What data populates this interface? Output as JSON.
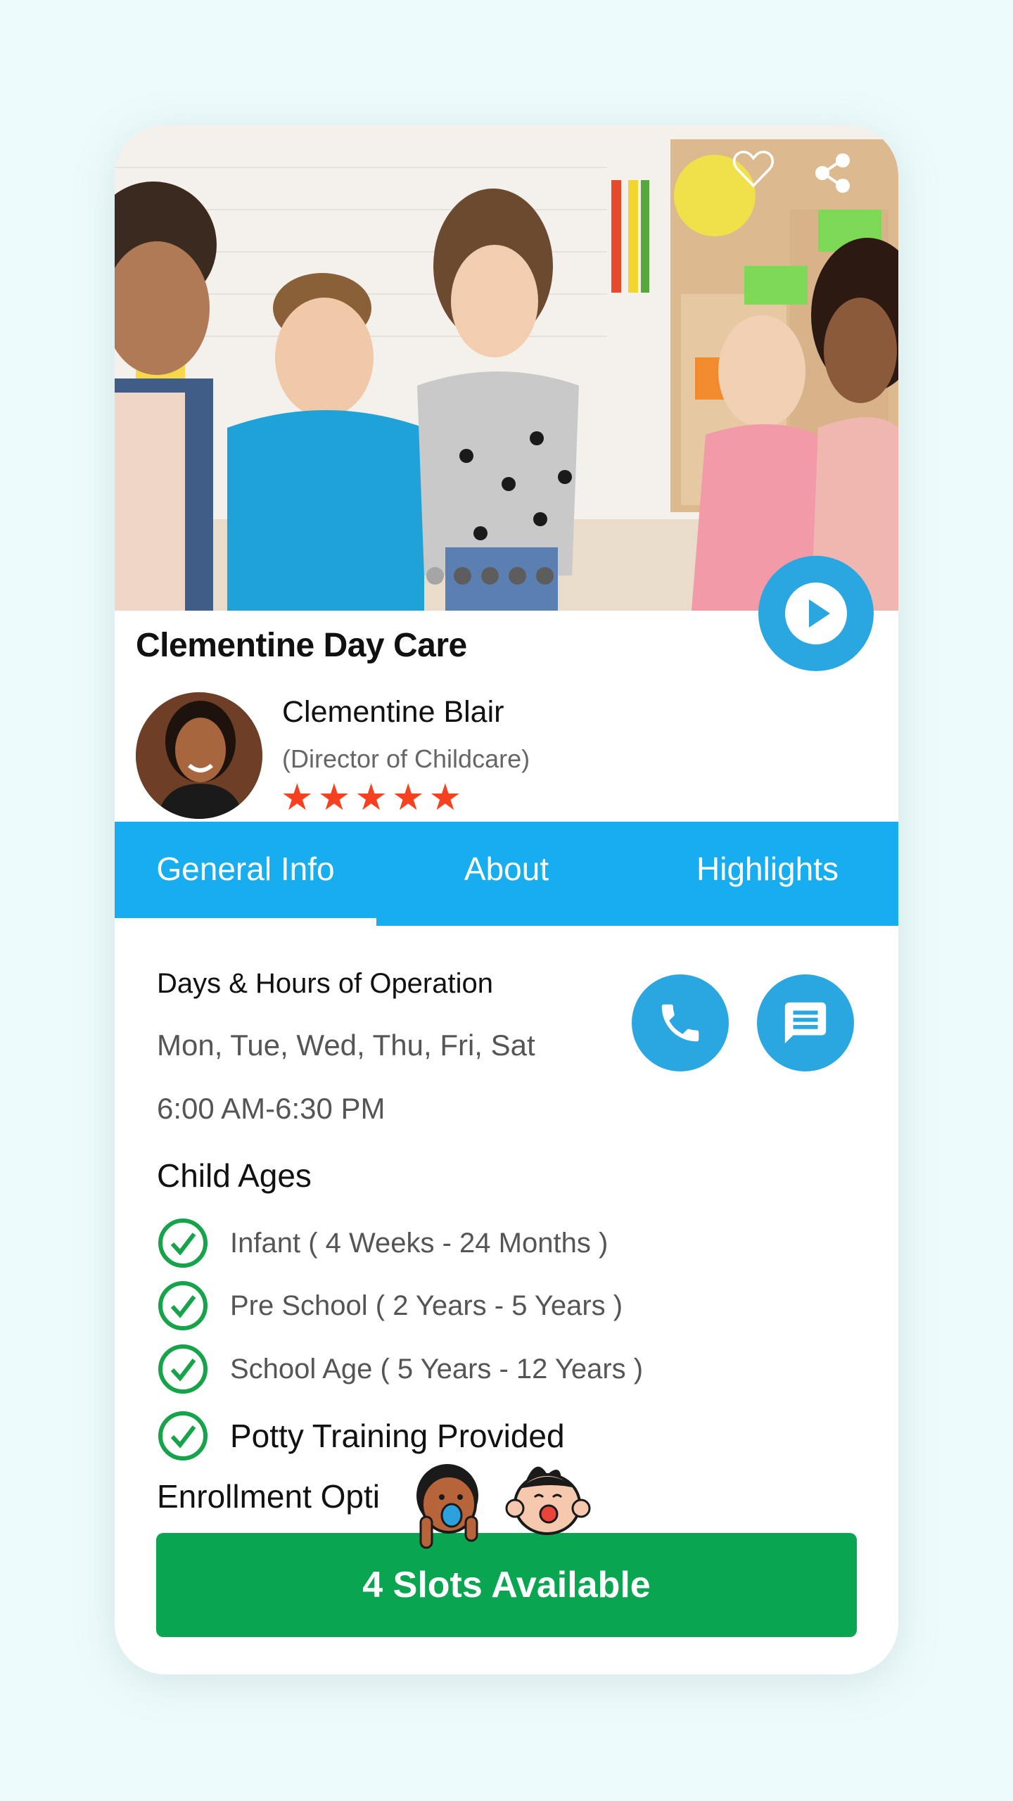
{
  "colors": {
    "page_background": "#eefbfc",
    "primary_blue": "#2aa7e1",
    "tab_bar_blue": "#17adee",
    "check_green": "#16a34a",
    "cta_green": "#0aa550",
    "star_red": "#f5411f"
  },
  "hero": {
    "image_alt": "Children sitting in a daycare classroom",
    "icons": [
      "heart-outline-icon",
      "share-icon",
      "play-icon"
    ],
    "carousel": {
      "total_slides": 5,
      "active_index": 0
    }
  },
  "daycare": {
    "name": "Clementine Day Care"
  },
  "director": {
    "name": "Clementine Blair",
    "role": "(Director of Childcare)",
    "rating": 5,
    "rating_max": 5
  },
  "tabs": [
    {
      "label": "General Info",
      "active": true
    },
    {
      "label": "About",
      "active": false
    },
    {
      "label": "Highlights",
      "active": false
    }
  ],
  "hours": {
    "heading": "Days & Hours of Operation",
    "days": "Mon, Tue, Wed, Thu, Fri, Sat",
    "time": "6:00 AM-6:30 PM"
  },
  "contact_buttons": [
    "phone-icon",
    "message-icon"
  ],
  "child_ages": {
    "heading": "Child Ages",
    "items": [
      "Infant ( 4 Weeks - 24 Months )",
      "Pre School ( 2 Years - 5 Years )",
      "School Age ( 5 Years - 12 Years )"
    ],
    "extra": "Potty Training Provided"
  },
  "enrollment": {
    "heading": "Enrollment Opti",
    "cta_label": "4 Slots Available"
  }
}
